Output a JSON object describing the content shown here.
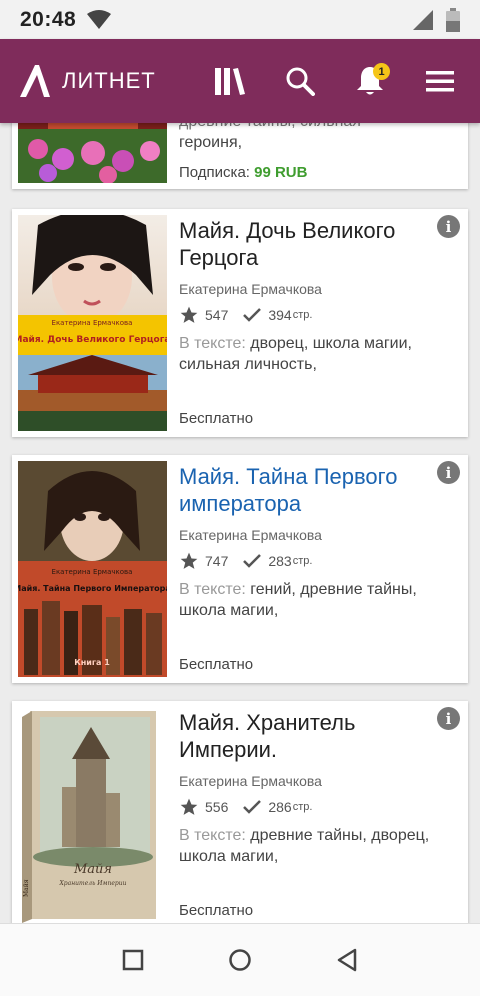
{
  "status_bar": {
    "time": "20:48"
  },
  "app_bar": {
    "logo_text": "ЛИТНЕТ",
    "notification_count": "1",
    "accent": "#7f2c5b"
  },
  "partial_card": {
    "tags_line1": "древние тайны, сильная",
    "tags_line2": "героиня,",
    "subscription_label": "Подписка:",
    "subscription_price": "99 RUB"
  },
  "books": [
    {
      "title": "Майя. Дочь Великого Герцога",
      "author": "Екатерина Ермачкова",
      "rating": "547",
      "pages": "394",
      "pages_unit": "стр.",
      "tags_label": "В тексте:",
      "tags": "дворец, школа магии, сильная личность,",
      "price": "Бесплатно",
      "cover_author": "Екатерина Ермачкова",
      "cover_title": "Майя. Дочь Великого Герцога"
    },
    {
      "title": "Майя. Тайна Первого императора",
      "author": "Екатерина Ермачкова",
      "rating": "747",
      "pages": "283",
      "pages_unit": "стр.",
      "tags_label": "В тексте:",
      "tags": "гений, древние тайны, школа магии,",
      "price": "Бесплатно",
      "cover_author": "Екатерина Ермачкова",
      "cover_title": "Майя. Тайна Первого Императора",
      "cover_book": "Книга 1"
    },
    {
      "title": "Майя. Хранитель Империи.",
      "author": "Екатерина Ермачкова",
      "rating": "556",
      "pages": "286",
      "pages_unit": "стр.",
      "tags_label": "В тексте:",
      "tags": "древние тайны, дворец, школа магии,",
      "price": "Бесплатно",
      "cover_title": "Майя",
      "cover_subtitle": "Хранитель Империи",
      "cover_spine": "Майя"
    }
  ]
}
